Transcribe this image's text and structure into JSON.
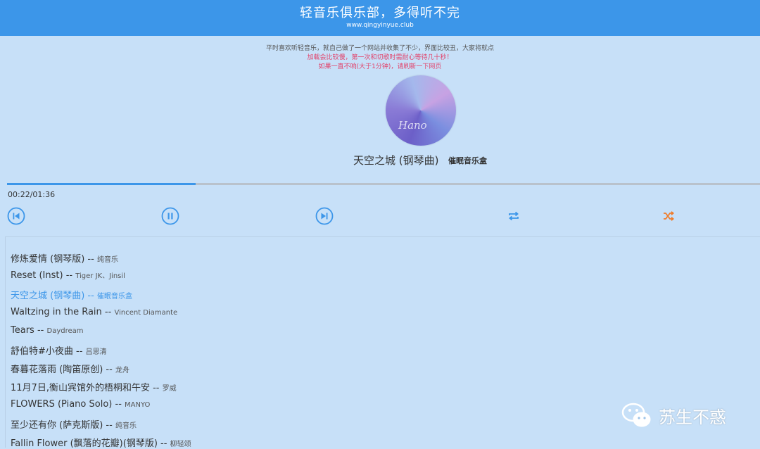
{
  "header": {
    "title": "轻音乐俱乐部，多得听不完",
    "url": "www.qingyinyue.club"
  },
  "notices": [
    "平时喜欢听轻音乐，就自己做了一个网站并收集了不少，界面比较丑，大家将就点",
    "加载会比较慢，第一次和切歌时需耐心等待几十秒！",
    "如果一直不响(大于1分钟)，请刷新一下网页"
  ],
  "now_playing": {
    "title": "天空之城 (钢琴曲)",
    "artist": "催眠音乐盒",
    "cover_text": "Hano"
  },
  "player": {
    "current_time": "00:22",
    "duration": "01:36",
    "time_display": "00:22/01:36",
    "progress": 0.25
  },
  "controls": {
    "prev_icon": "skip-previous-icon",
    "pause_icon": "pause-icon",
    "next_icon": "skip-next-icon",
    "repeat_icon": "repeat-icon",
    "shuffle_icon": "shuffle-icon"
  },
  "playlist": [
    {
      "title": "修炼爱情 (钢琴版)",
      "artist": "纯音乐",
      "active": false
    },
    {
      "title": "Reset (Inst)",
      "artist": "Tiger JK、Jinsil",
      "active": false
    },
    {
      "title": "天空之城 (钢琴曲)",
      "artist": "催眠音乐盒",
      "active": true
    },
    {
      "title": "Waltzing in the Rain",
      "artist": "Vincent Diamante",
      "active": false
    },
    {
      "title": "Tears",
      "artist": "Daydream",
      "active": false
    },
    {
      "title": "舒伯特#小夜曲",
      "artist": "吕思清",
      "active": false
    },
    {
      "title": "春暮花落雨 (陶笛原创)",
      "artist": "龙舟",
      "active": false
    },
    {
      "title": "11月7日,衡山宾馆外的梧桐和午安",
      "artist": "罗威",
      "active": false
    },
    {
      "title": "FLOWERS (Piano Solo)",
      "artist": "MANYO",
      "active": false
    },
    {
      "title": "至少还有你 (萨克斯版)",
      "artist": "纯音乐",
      "active": false
    },
    {
      "title": "Fallin Flower (飘落的花瓣)(钢琴版)",
      "artist": "柳轻颂",
      "active": false
    }
  ],
  "separator": "--",
  "watermark": {
    "text": "苏生不惑",
    "icon": "wechat-icon"
  },
  "colors": {
    "header": "#3c96e9",
    "background": "#c7e0f8",
    "accent": "#3c96e9",
    "shuffle": "#f07c2a",
    "notice_red": "#e2436b"
  }
}
